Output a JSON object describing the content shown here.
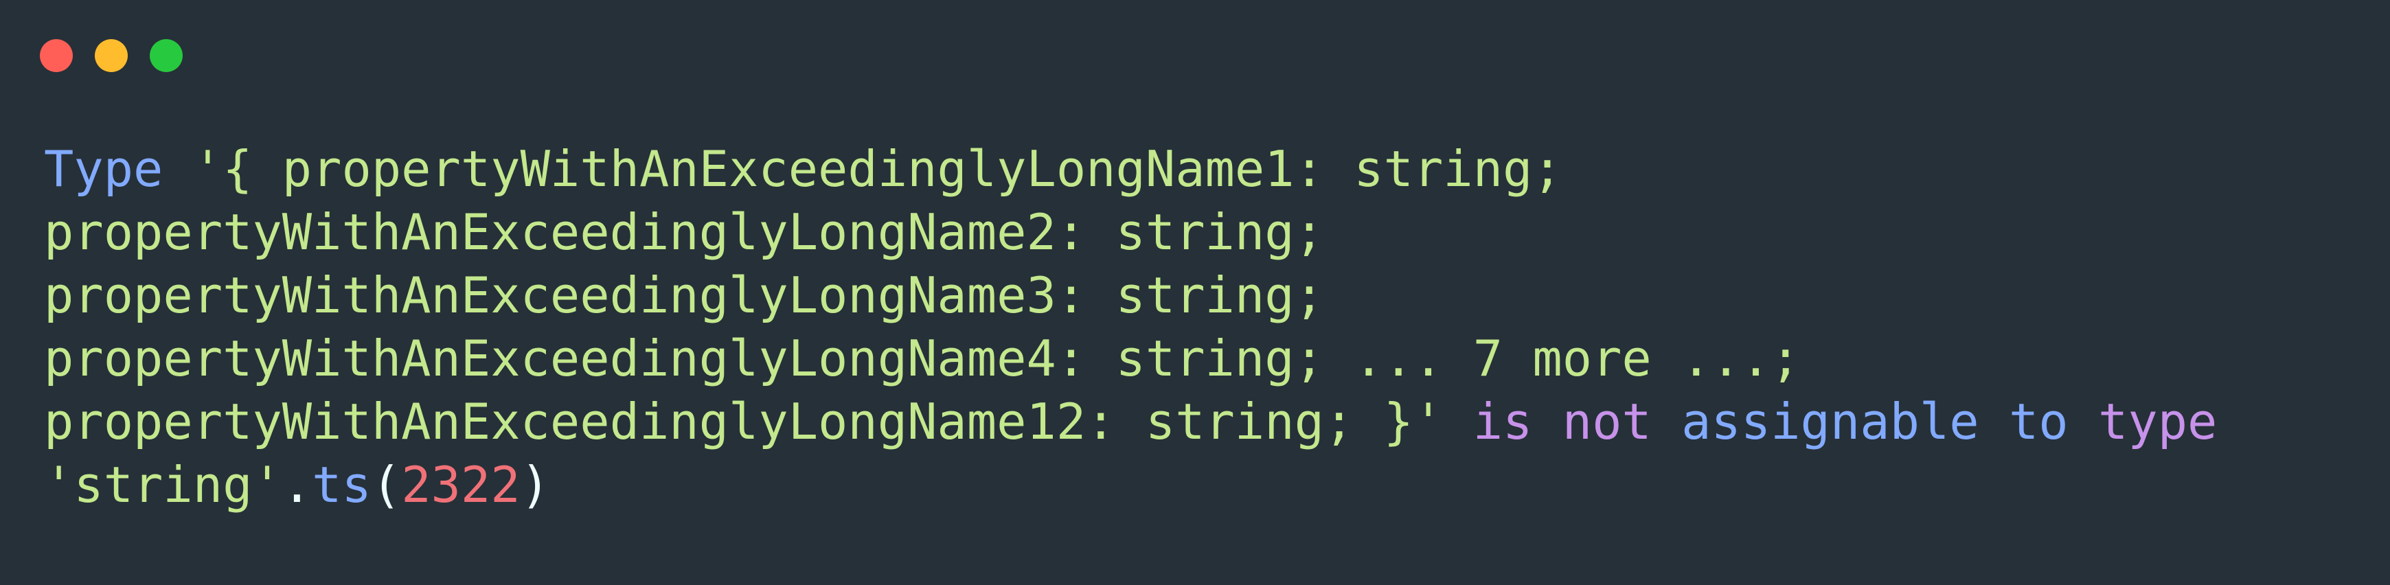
{
  "window": {
    "controls": [
      {
        "name": "close-button",
        "color": "#ff5f56"
      },
      {
        "name": "minimize-button",
        "color": "#ffbd2e"
      },
      {
        "name": "maximize-button",
        "color": "#27c93f"
      }
    ]
  },
  "colors": {
    "background": "#263038",
    "keyword": "#82aaff",
    "string": "#c3e88d",
    "punctuation": "#c3e88d",
    "operator": "#c792ea",
    "property": "#82aaff",
    "number": "#f07178",
    "plain": "#eeffff"
  },
  "code": {
    "lines": [
      [
        {
          "text": "Type",
          "kind": "keyword"
        },
        {
          "text": " '{ propertyWithAnExceedinglyLongName1: string;",
          "kind": "string"
        }
      ],
      [
        {
          "text": "propertyWithAnExceedinglyLongName2: string;",
          "kind": "string"
        }
      ],
      [
        {
          "text": "propertyWithAnExceedinglyLongName3: string;",
          "kind": "string"
        }
      ],
      [
        {
          "text": "propertyWithAnExceedinglyLongName4: string; ... 7 more ...;",
          "kind": "string"
        }
      ],
      [
        {
          "text": "propertyWithAnExceedinglyLongName12: string; }'",
          "kind": "string"
        },
        {
          "text": " is not",
          "kind": "operator"
        },
        {
          "text": " assignable to",
          "kind": "keyword"
        },
        {
          "text": " type",
          "kind": "operator"
        }
      ],
      [
        {
          "text": "'string'",
          "kind": "string"
        },
        {
          "text": ".",
          "kind": "plain"
        },
        {
          "text": "ts",
          "kind": "property"
        },
        {
          "text": "(",
          "kind": "plain"
        },
        {
          "text": "2322",
          "kind": "number"
        },
        {
          "text": ")",
          "kind": "plain"
        }
      ]
    ]
  }
}
